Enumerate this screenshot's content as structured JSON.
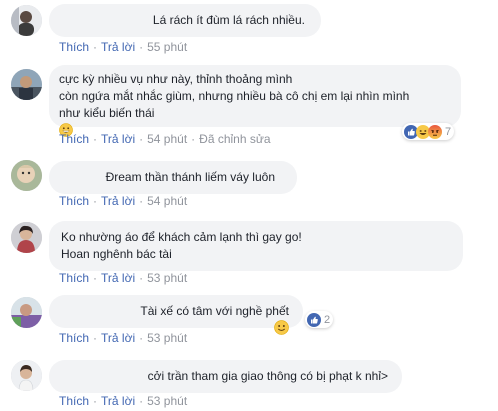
{
  "actions": {
    "like": "Thích",
    "reply": "Trả lời",
    "edited": "Đã chỉnh sửa"
  },
  "comments": [
    {
      "text": "Lá rách ít đùm lá rách nhiều.",
      "time": "55 phút"
    },
    {
      "text": "cực kỳ nhiều vụ như này, thỉnh thoảng mình\ncòn ngứa mắt nhắc giùm, nhưng nhiều bà cô chị em lại nhìn mình\nnhư kiểu biến thái",
      "time": "54 phút",
      "reaction_count": "7",
      "reactions": [
        "like-icon",
        "haha-icon",
        "angry-icon"
      ]
    },
    {
      "text": "Đream thần thánh liếm váy luôn",
      "time": "54 phút"
    },
    {
      "text": "Ko nhường áo để khách cảm lạnh thì gay go!\nHoan nghênh bác tài",
      "time": "53 phút"
    },
    {
      "text": "Tài xế có tâm với nghề phết",
      "time": "53 phút",
      "reaction_count": "2",
      "reactions": [
        "like-icon"
      ]
    },
    {
      "text": "cởi trần tham gia giao thông có bị phạt k nhỉ>",
      "time": "53 phút"
    }
  ],
  "colors": {
    "link": "#4267b2",
    "bubble": "#f2f3f5",
    "meta": "#90949c",
    "text": "#1d2129"
  }
}
